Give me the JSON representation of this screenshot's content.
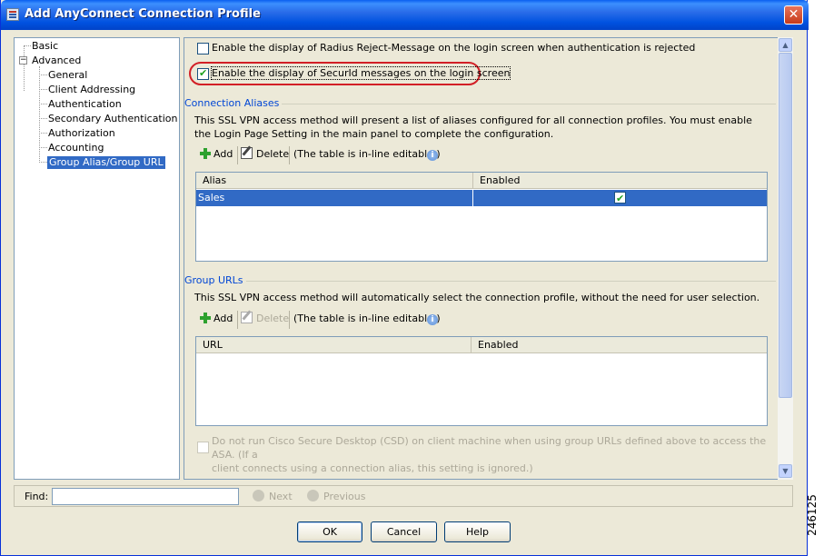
{
  "window": {
    "title": "Add AnyConnect Connection Profile",
    "close_glyph": "✕"
  },
  "tree": {
    "items": [
      {
        "label": "Basic"
      },
      {
        "label": "Advanced",
        "expander": "−"
      },
      {
        "label": "General"
      },
      {
        "label": "Client Addressing"
      },
      {
        "label": "Authentication"
      },
      {
        "label": "Secondary Authentication"
      },
      {
        "label": "Authorization"
      },
      {
        "label": "Accounting"
      },
      {
        "label": "Group Alias/Group URL",
        "selected": true
      }
    ]
  },
  "options": {
    "radius_reject": {
      "label": "Enable the display of Radius Reject-Message on the login screen when authentication is rejected",
      "checked": false
    },
    "securid": {
      "label": "Enable the display of SecurId messages on the login screen",
      "checked": true
    }
  },
  "connection_aliases": {
    "title": "Connection Aliases",
    "description": "This SSL VPN access method will present a list of aliases configured for all connection profiles. You must enable the Login Page Setting in the main panel to complete the configuration.",
    "add_label": "Add",
    "delete_label": "Delete",
    "editable_note": "(The table is in-line editable.)",
    "columns": [
      "Alias",
      "Enabled"
    ],
    "rows": [
      {
        "alias": "Sales",
        "enabled": true
      }
    ]
  },
  "group_urls": {
    "title": "Group URLs",
    "description": "This SSL VPN access method will automatically select the connection profile, without the need for user selection.",
    "add_label": "Add",
    "delete_label": "Delete",
    "editable_note": "(The table is in-line editable.)",
    "columns": [
      "URL",
      "Enabled"
    ],
    "rows": []
  },
  "csd_option": {
    "label_line1": "Do not run Cisco Secure Desktop (CSD) on client machine when using group URLs defined above to access the ASA. (If a",
    "label_line2": "client connects using a connection alias, this setting is ignored.)",
    "checked": false,
    "enabled": false
  },
  "find": {
    "label": "Find:",
    "value": "",
    "next_label": "Next",
    "previous_label": "Previous"
  },
  "buttons": {
    "ok": "OK",
    "cancel": "Cancel",
    "help": "Help"
  },
  "figure_number": "246125",
  "colors": {
    "selection": "#316ac5",
    "group_title": "#0046d5",
    "highlight": "#d21f26",
    "titlebar": "#0052e0"
  }
}
